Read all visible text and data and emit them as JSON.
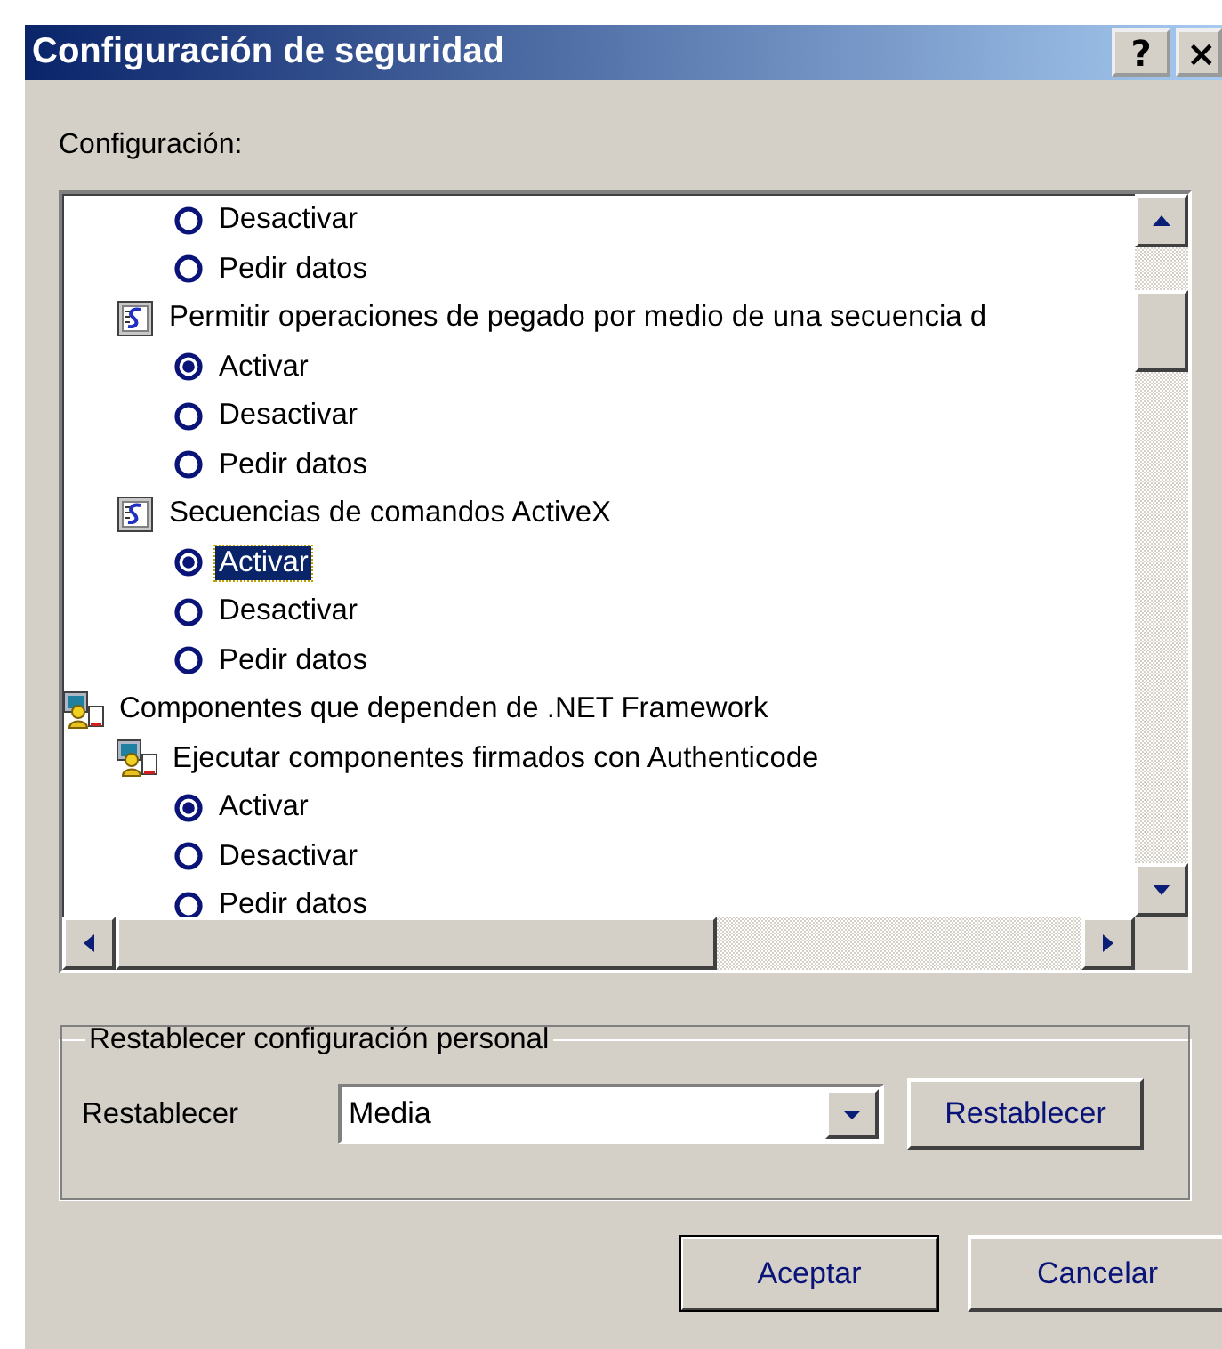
{
  "window": {
    "title": "Configuración de seguridad",
    "title_buttons": [
      {
        "kind": "help",
        "label": "?"
      },
      {
        "kind": "close",
        "label": "×"
      }
    ]
  },
  "settings": {
    "label": "Configuración:",
    "tree": [
      {
        "children": [
          {
            "children": [
              {
                "kind": "radio",
                "label": "Desactivar",
                "selected": false,
                "focused": false
              },
              {
                "kind": "radio",
                "label": "Pedir datos",
                "selected": false,
                "focused": false
              }
            ]
          },
          {
            "kind": "script",
            "label": "Permitir operaciones de pegado por medio de una secuencia d",
            "children": [
              {
                "kind": "radio",
                "label": "Activar",
                "selected": true,
                "focused": false
              },
              {
                "kind": "radio",
                "label": "Desactivar",
                "selected": false,
                "focused": false
              },
              {
                "kind": "radio",
                "label": "Pedir datos",
                "selected": false,
                "focused": false
              }
            ]
          },
          {
            "kind": "script",
            "label": "Secuencias de comandos ActiveX",
            "children": [
              {
                "kind": "radio",
                "label": "Activar",
                "selected": true,
                "focused": true
              },
              {
                "kind": "radio",
                "label": "Desactivar",
                "selected": false,
                "focused": false
              },
              {
                "kind": "radio",
                "label": "Pedir datos",
                "selected": false,
                "focused": false
              }
            ]
          }
        ]
      },
      {
        "kind": "component",
        "label": "Componentes que dependen de .NET Framework",
        "children": [
          {
            "kind": "component",
            "label": "Ejecutar componentes firmados con Authenticode",
            "children": [
              {
                "kind": "radio",
                "label": "Activar",
                "selected": true,
                "focused": false
              },
              {
                "kind": "radio",
                "label": "Desactivar",
                "selected": false,
                "focused": false
              },
              {
                "kind": "radio",
                "label": "Pedir datos",
                "selected": false,
                "focused": false
              }
            ]
          }
        ]
      }
    ]
  },
  "reset": {
    "group_title": "Restablecer configuración personal",
    "label": "Restablecer",
    "value": "Media",
    "button": "Restablecer"
  },
  "buttons": [
    {
      "label": "Aceptar",
      "default": true
    },
    {
      "label": "Cancelar",
      "default": false
    }
  ]
}
